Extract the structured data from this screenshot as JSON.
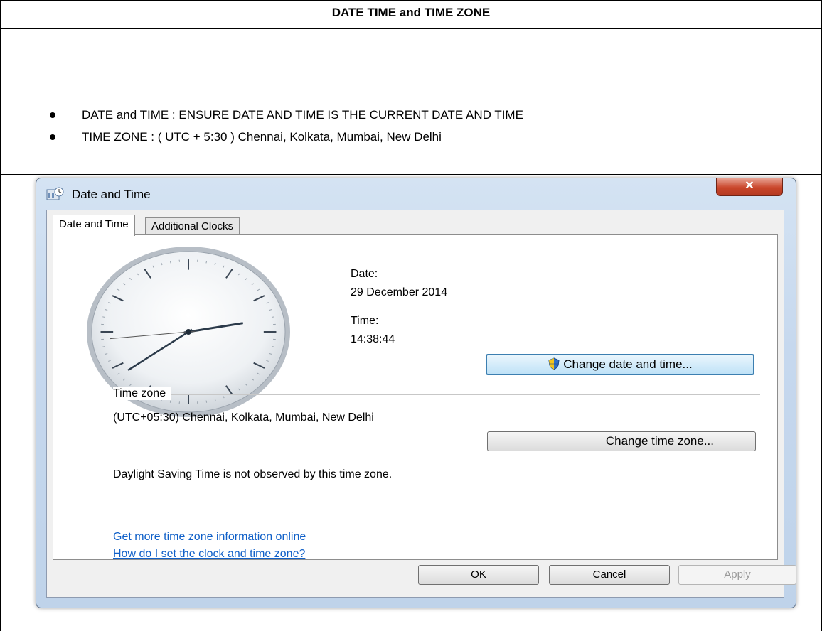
{
  "document": {
    "title": "DATE TIME and TIME ZONE",
    "bullets": [
      "DATE and TIME : ENSURE DATE AND TIME IS THE CURRENT DATE AND TIME",
      "TIME ZONE : (  UTC + 5:30 ) Chennai, Kolkata, Mumbai, New Delhi"
    ]
  },
  "window": {
    "title": "Date and Time",
    "close_label": "✕",
    "tabs": [
      {
        "label": "Date and Time",
        "active": true
      },
      {
        "label": "Additional Clocks",
        "active": false
      }
    ],
    "clock": {
      "hour": 14,
      "minute": 38,
      "second": 44
    },
    "date_label": "Date:",
    "date_value": "29 December 2014",
    "time_label": "Time:",
    "time_value": "14:38:44",
    "change_datetime_label": "Change date and time...",
    "timezone_group_label": "Time zone",
    "timezone_value": "(UTC+05:30) Chennai, Kolkata, Mumbai, New Delhi",
    "change_timezone_label": "Change time zone...",
    "dst_text": "Daylight Saving Time is not observed by this time zone.",
    "links": [
      "Get more time zone information online",
      "How do I set the clock and time zone?"
    ],
    "buttons": {
      "ok": "OK",
      "cancel": "Cancel",
      "apply": "Apply"
    }
  },
  "colors": {
    "link": "#1060c8",
    "accent_button": "#3c7fb1",
    "close_button": "#c9452a"
  },
  "icons": [
    "datetime-app-icon",
    "close-icon",
    "shield-icon",
    "clock-face"
  ]
}
